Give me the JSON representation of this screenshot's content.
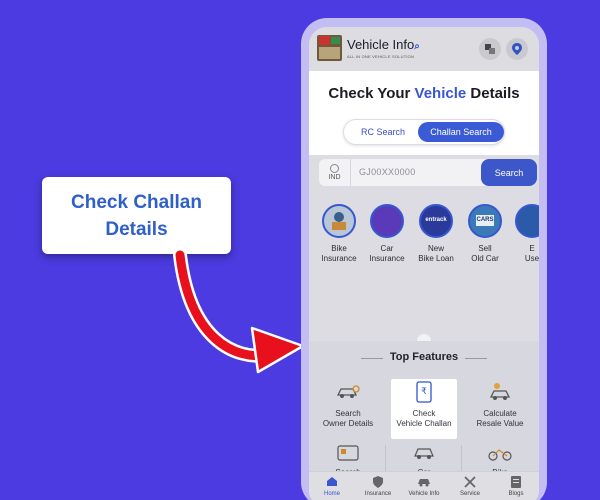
{
  "callout": {
    "line1": "Check Challan",
    "line2": "Details"
  },
  "app": {
    "title": "Vehicle Info",
    "subtitle": "ALL IN ONE VEHICLE SOLUTION"
  },
  "hero": {
    "title_prefix": "Check Your ",
    "title_accent": "Vehicle",
    "title_suffix": " Details"
  },
  "toggle": {
    "rc": "RC Search",
    "challan": "Challan Search",
    "selected": "Challan Search"
  },
  "search": {
    "country": "IND",
    "placeholder": "GJ00XX0000",
    "button": "Search"
  },
  "categories": [
    {
      "l1": "Bike",
      "l2": "Insurance"
    },
    {
      "l1": "Car",
      "l2": "Insurance"
    },
    {
      "l1": "New",
      "l2": "Bike Loan"
    },
    {
      "l1": "Sell",
      "l2": "Old Car"
    },
    {
      "l1": "E",
      "l2": "Use"
    }
  ],
  "features": {
    "title": "Top Features",
    "items": [
      {
        "l1": "Search",
        "l2": "Owner Details"
      },
      {
        "l1": "Check",
        "l2": "Vehicle Challan"
      },
      {
        "l1": "Calculate",
        "l2": "Resale Value"
      }
    ],
    "row2": [
      "Search",
      "Car",
      "Bike"
    ]
  },
  "nav": [
    "Home",
    "Insurance",
    "Vehicle Info",
    "Service",
    "Blogs"
  ],
  "colors": {
    "background": "#4b3be0",
    "accent": "#3b55cf",
    "arrow": "#e8101c"
  }
}
